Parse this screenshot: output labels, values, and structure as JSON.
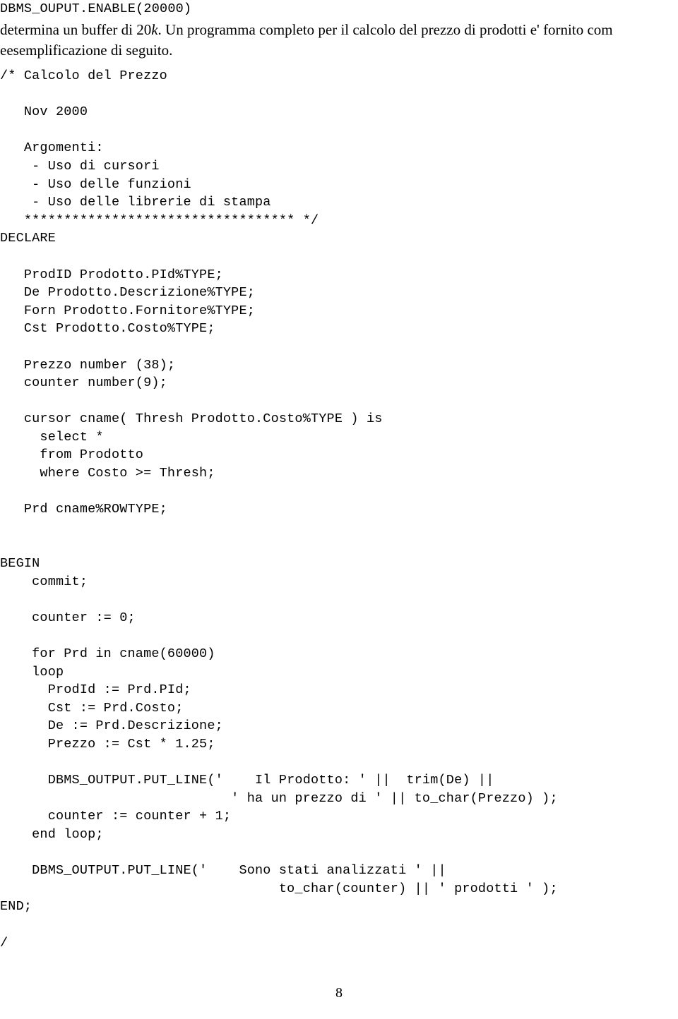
{
  "document": {
    "page_number": "8",
    "intro": {
      "code_fragment": "DBMS_OUPUT.ENABLE(20000)",
      "paragraph_part1": "determina un buffer di 20",
      "paragraph_italic": "k",
      "paragraph_part2": ". Un programma completo per il calcolo del prezzo di prodotti e' fornito com eesemplificazione di seguito."
    },
    "code_listing": {
      "language": "PL/SQL",
      "lines": [
        "/* Calcolo del Prezzo",
        "",
        "   Nov 2000",
        "",
        "   Argomenti:",
        "    - Uso di cursori",
        "    - Uso delle funzioni",
        "    - Uso delle librerie di stampa",
        "   ********************************** */",
        "DECLARE",
        "",
        "   ProdID Prodotto.PId%TYPE;",
        "   De Prodotto.Descrizione%TYPE;",
        "   Forn Prodotto.Fornitore%TYPE;",
        "   Cst Prodotto.Costo%TYPE;",
        "",
        "   Prezzo number (38);",
        "   counter number(9);",
        "",
        "   cursor cname( Thresh Prodotto.Costo%TYPE ) is",
        "     select *",
        "     from Prodotto",
        "     where Costo >= Thresh;",
        "",
        "   Prd cname%ROWTYPE;",
        "",
        "",
        "BEGIN",
        "    commit;",
        "",
        "    counter := 0;",
        "",
        "    for Prd in cname(60000)",
        "    loop",
        "      ProdId := Prd.PId;",
        "      Cst := Prd.Costo;",
        "      De := Prd.Descrizione;",
        "      Prezzo := Cst * 1.25;",
        "",
        "      DBMS_OUTPUT.PUT_LINE('    Il Prodotto: ' ||  trim(De) ||",
        "                             ' ha un prezzo di ' || to_char(Prezzo) );",
        "      counter := counter + 1;",
        "    end loop;",
        "",
        "    DBMS_OUTPUT.PUT_LINE('    Sono stati analizzati ' ||",
        "                                   to_char(counter) || ' prodotti ' );",
        "END;",
        "",
        "/"
      ]
    }
  }
}
